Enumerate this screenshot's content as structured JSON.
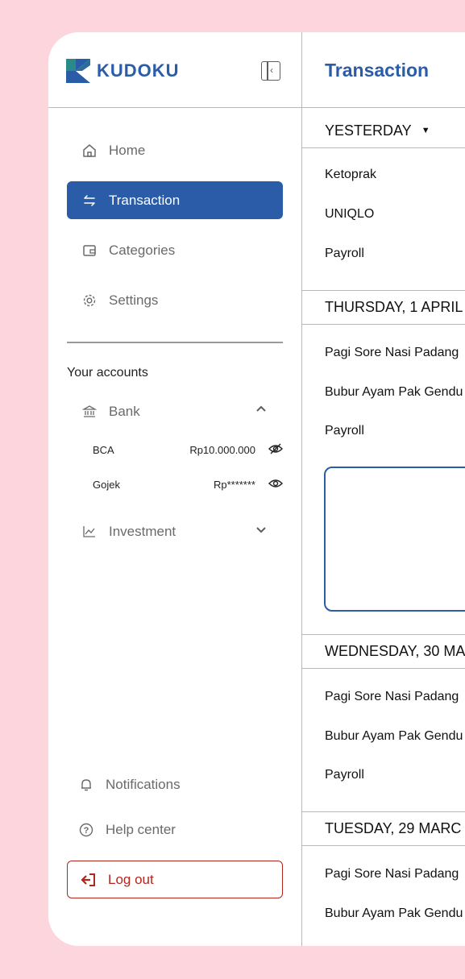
{
  "brand": {
    "name": "KUDOKU",
    "primary": "#2b5ca8",
    "danger": "#b3261e",
    "background": "#fdd5dc"
  },
  "sidebar": {
    "nav": [
      {
        "label": "Home",
        "icon": "home-icon",
        "active": false
      },
      {
        "label": "Transaction",
        "icon": "swap-arrows-icon",
        "active": true
      },
      {
        "label": "Categories",
        "icon": "wallet-icon",
        "active": false
      },
      {
        "label": "Settings",
        "icon": "gear-icon",
        "active": false
      }
    ],
    "accounts_title": "Your accounts",
    "groups": {
      "bank": {
        "label": "Bank",
        "expanded": true,
        "accounts": [
          {
            "name": "BCA",
            "amount": "Rp10.000.000",
            "icon": "eye-off-icon"
          },
          {
            "name": "Gojek",
            "amount": "Rp*******",
            "icon": "eye-icon"
          }
        ]
      },
      "investment": {
        "label": "Investment",
        "expanded": false
      }
    },
    "bottom": {
      "notifications": "Notifications",
      "help": "Help center",
      "logout": "Log out"
    }
  },
  "main": {
    "title": "Transaction",
    "sections": [
      {
        "heading": "YESTERDAY",
        "items": [
          "Ketoprak",
          "UNIQLO",
          "Payroll"
        ]
      },
      {
        "heading": "THURSDAY, 1 APRIL",
        "items": [
          "Pagi Sore Nasi Padang",
          "Bubur Ayam Pak Gendu",
          "Payroll"
        ]
      },
      {
        "heading": "WEDNESDAY, 30 MA",
        "items": [
          "Pagi Sore Nasi Padang",
          "Bubur Ayam Pak Gendu",
          "Payroll"
        ]
      },
      {
        "heading": "TUESDAY, 29 MARC",
        "items": [
          "Pagi Sore Nasi Padang",
          "Bubur Ayam Pak Gendu"
        ]
      }
    ]
  }
}
